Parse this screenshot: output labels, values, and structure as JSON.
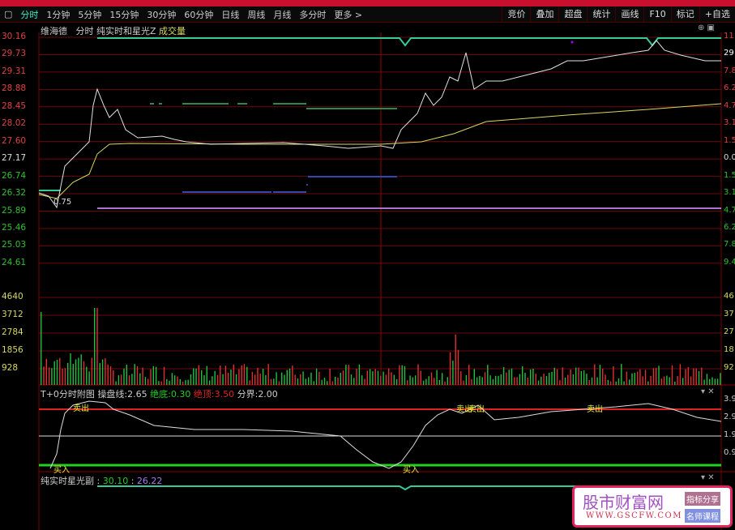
{
  "toolbar": {
    "periods": [
      "分时",
      "1分钟",
      "5分钟",
      "15分钟",
      "30分钟",
      "60分钟",
      "日线",
      "周线",
      "月线",
      "多分时",
      "更多 >"
    ],
    "tools": [
      "竞价",
      "叠加",
      "超盘",
      "统计",
      "画线",
      "F10",
      "标记",
      "+自选"
    ]
  },
  "main": {
    "stock": "维海德",
    "mode": "分时",
    "indicator": "纯实时和星光Z",
    "volume_label": "成交量",
    "low_marker": "0.75",
    "price_axis": [
      "30.16",
      "29.73",
      "29.31",
      "28.88",
      "28.45",
      "28.02",
      "27.60",
      "27.17",
      "26.74",
      "26.32",
      "25.89",
      "25.46",
      "25.03",
      "24.61"
    ],
    "volume_axis": [
      "4640",
      "3712",
      "2784",
      "1856",
      "928"
    ],
    "right_axis": [
      "11",
      "29",
      "7.8",
      "6.2",
      "4.7",
      "3.1",
      "1.5",
      "0.0",
      "1.5",
      "3.1",
      "4.7",
      "6.2",
      "7.8",
      "9.4",
      "46",
      "37",
      "27",
      "18",
      "92"
    ]
  },
  "sub1": {
    "name": "T+0分时附图",
    "l1": "操盘线:",
    "v1": "2.65",
    "l2": "绝底:",
    "v2": "0.30",
    "l3": "绝顶:",
    "v3": "3.50",
    "l4": "分界:",
    "v4": "2.00",
    "sell": "卖出",
    "buy": "买入",
    "right_axis": [
      "3.9",
      "2.9",
      "1.9",
      "0.9"
    ]
  },
  "sub2": {
    "name": "纯实时星光副",
    "v1": "30.10",
    "v2": "26.22"
  },
  "watermark": {
    "title": "股市财富网",
    "url": "WWW.GSCFW.COM",
    "tag1": "指标分享",
    "tag2": "名师课程"
  },
  "colors": {
    "up": "#e03030",
    "down": "#22c040",
    "price": "#e0e0e0",
    "avg": "#d8d860"
  }
}
